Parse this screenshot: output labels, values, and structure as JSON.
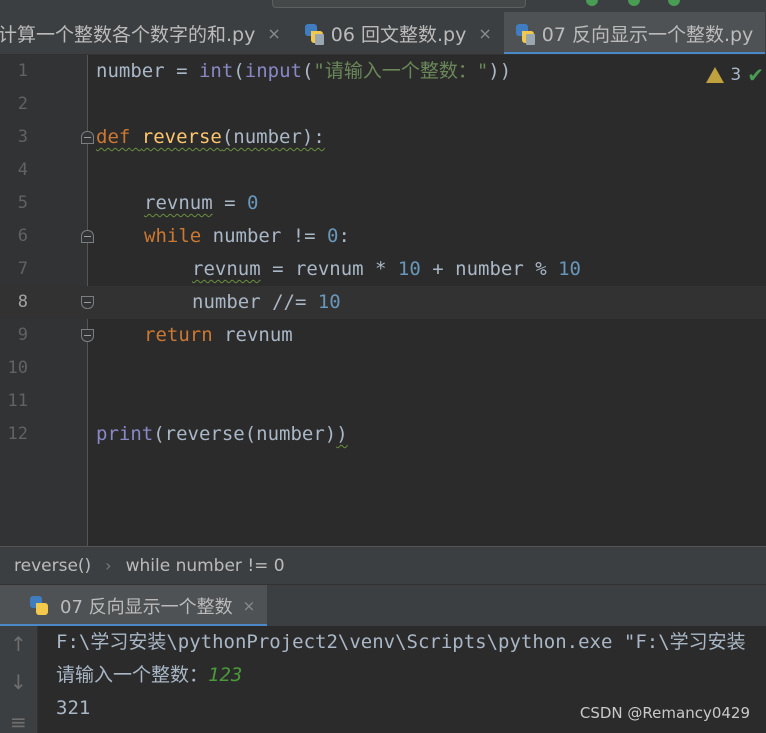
{
  "tabs": [
    {
      "label": "计算一个整数各个数字的和.py",
      "active": false
    },
    {
      "label": "06 回文整数.py",
      "active": false
    },
    {
      "label": "07 反向显示一个整数.py",
      "active": true
    }
  ],
  "editor": {
    "line_numbers": [
      "1",
      "2",
      "3",
      "4",
      "5",
      "6",
      "7",
      "8",
      "9",
      "10",
      "11",
      "12"
    ],
    "current_line": "8",
    "inspection_count": "3",
    "code": {
      "l1": {
        "var": "number",
        "op": " = ",
        "fn1": "int",
        "p1": "(",
        "fn2": "input",
        "p2": "(",
        "str": "\"请输入一个整数：\"",
        "p3": "))"
      },
      "l3": {
        "kw": "def",
        "sp": " ",
        "name": "reverse",
        "args": "(number):"
      },
      "l5": {
        "var": "revnum",
        "op": " = ",
        "num": "0"
      },
      "l6": {
        "kw": "while",
        "rest": " number != ",
        "num": "0",
        "colon": ":"
      },
      "l7": {
        "var": "revnum",
        "mid": " = revnum * ",
        "n1": "10",
        "mid2": " + number % ",
        "n2": "10"
      },
      "l8": {
        "text": "number //= ",
        "num": "10"
      },
      "l9": {
        "kw": "return",
        "rest": " revnum"
      },
      "l12": {
        "fn": "print",
        "rest": "(reverse(number)",
        "close": ")"
      }
    }
  },
  "breadcrumb": [
    "reverse()",
    "while number != 0"
  ],
  "breadcrumb_sep": "›",
  "run": {
    "tab_label": "07 反向显示一个整数",
    "close": "×",
    "output": {
      "command": "F:\\学习安装\\pythonProject2\\venv\\Scripts\\python.exe \"F:\\学习安装",
      "prompt": "请输入一个整数：",
      "input": "123",
      "result": "321"
    }
  },
  "watermark": "CSDN @Remancy0429",
  "colors": {
    "keyword": "#cc7832",
    "builtin": "#8888c6",
    "number": "#6897bb",
    "string": "#6a8759",
    "function": "#ffc66d",
    "accent": "#4a88c7"
  }
}
